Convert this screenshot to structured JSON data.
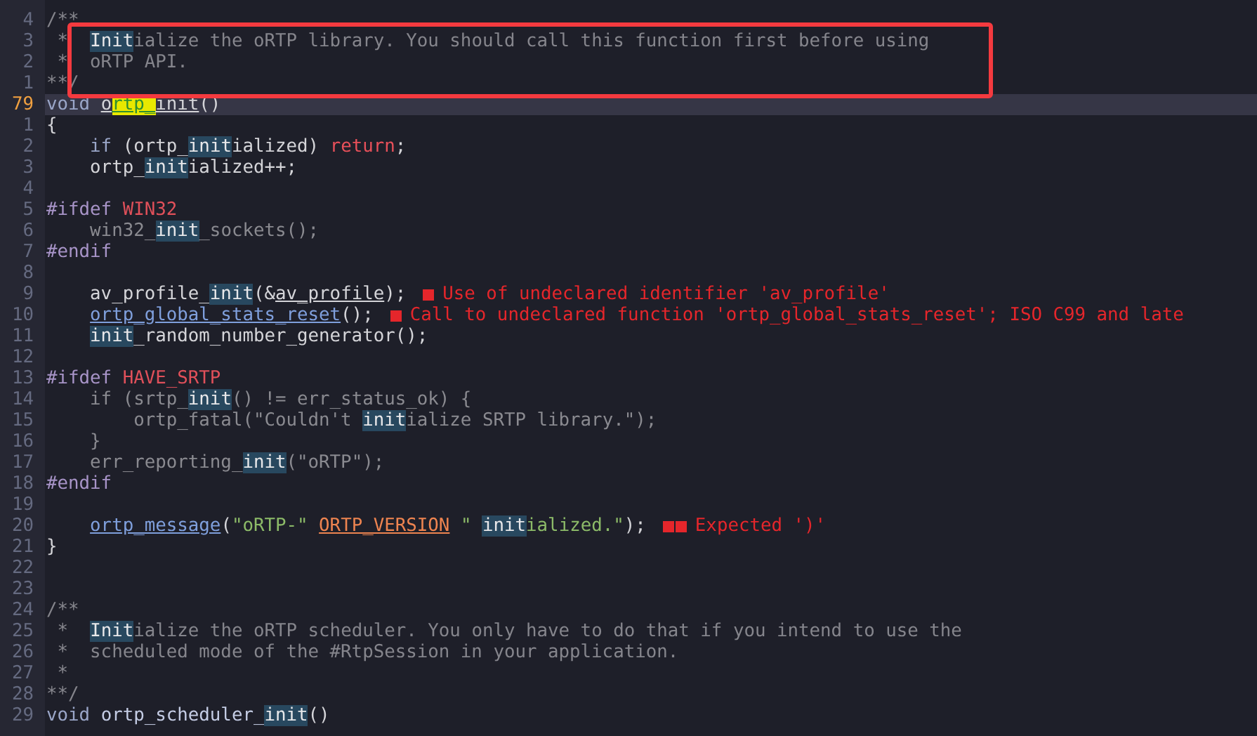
{
  "lines": [
    {
      "number": "4",
      "current": false,
      "segments": [
        {
          "text": "/**",
          "kind": "comment"
        }
      ]
    },
    {
      "number": "3",
      "current": false,
      "segments": [
        {
          "text": " *  ",
          "kind": "comment"
        },
        {
          "text": "Init",
          "kind": "match"
        },
        {
          "text": "ialize the oRTP library. You should call this function first before using",
          "kind": "comment"
        }
      ]
    },
    {
      "number": "2",
      "current": false,
      "segments": [
        {
          "text": " *  oRTP API.",
          "kind": "comment"
        }
      ]
    },
    {
      "number": "1",
      "current": false,
      "segments": [
        {
          "text": "**/",
          "kind": "comment"
        }
      ]
    },
    {
      "number": "79",
      "current": true,
      "segments": [
        {
          "text": "void ",
          "kind": "keyword"
        },
        {
          "text": "o",
          "kind": "ref"
        },
        {
          "text": "rtp_",
          "kind": "search"
        },
        {
          "text": "init",
          "kind": "ref"
        },
        {
          "text": "()",
          "kind": "plain"
        }
      ]
    },
    {
      "number": "1",
      "current": false,
      "segments": [
        {
          "text": "{",
          "kind": "plain"
        }
      ]
    },
    {
      "number": "2",
      "current": false,
      "segments": [
        {
          "text": "    if",
          "kind": "keyword"
        },
        {
          "text": " (ortp_",
          "kind": "plain"
        },
        {
          "text": "init",
          "kind": "match"
        },
        {
          "text": "ialized) ",
          "kind": "plain"
        },
        {
          "text": "return",
          "kind": "control"
        },
        {
          "text": ";",
          "kind": "plain"
        }
      ]
    },
    {
      "number": "3",
      "current": false,
      "segments": [
        {
          "text": "    ortp_",
          "kind": "plain"
        },
        {
          "text": "init",
          "kind": "match"
        },
        {
          "text": "ialized++;",
          "kind": "plain"
        }
      ]
    },
    {
      "number": "4",
      "current": false
    },
    {
      "number": "5",
      "current": false,
      "segments": [
        {
          "text": "#ifdef ",
          "kind": "preproc"
        },
        {
          "text": "WIN32",
          "kind": "macro"
        }
      ]
    },
    {
      "number": "6",
      "current": false,
      "segments": [
        {
          "text": "    win32_",
          "kind": "dim"
        },
        {
          "text": "init",
          "kind": "match"
        },
        {
          "text": "_sockets();",
          "kind": "dim"
        }
      ]
    },
    {
      "number": "7",
      "current": false,
      "segments": [
        {
          "text": "#endif",
          "kind": "preproc"
        }
      ]
    },
    {
      "number": "8",
      "current": false
    },
    {
      "number": "9",
      "current": false,
      "segments": [
        {
          "text": "    av_profile_",
          "kind": "plain"
        },
        {
          "text": "init",
          "kind": "match"
        },
        {
          "text": "(&",
          "kind": "plain"
        },
        {
          "text": "av_profile",
          "kind": "ref"
        },
        {
          "text": ");",
          "kind": "plain"
        }
      ],
      "diagnostics": [
        {
          "kind": "error",
          "message": "Use of undeclared identifier 'av_profile'"
        }
      ]
    },
    {
      "number": "10",
      "current": false,
      "segments": [
        {
          "text": "    ortp_global_stats_reset",
          "kind": "func"
        },
        {
          "text": "();",
          "kind": "plain"
        }
      ],
      "diagnostics": [
        {
          "kind": "error",
          "message": "Call to undeclared function 'ortp_global_stats_reset'; ISO C99 and late"
        }
      ]
    },
    {
      "number": "11",
      "current": false,
      "segments": [
        {
          "text": "    init",
          "kind": "match"
        },
        {
          "text": "_random_number_generator();",
          "kind": "plain"
        }
      ]
    },
    {
      "number": "12",
      "current": false
    },
    {
      "number": "13",
      "current": false,
      "segments": [
        {
          "text": "#ifdef ",
          "kind": "preproc"
        },
        {
          "text": "HAVE_SRTP",
          "kind": "macro"
        }
      ]
    },
    {
      "number": "14",
      "current": false,
      "segments": [
        {
          "text": "    if (srtp_",
          "kind": "dim"
        },
        {
          "text": "init",
          "kind": "match"
        },
        {
          "text": "() != err_status_ok) {",
          "kind": "dim"
        }
      ]
    },
    {
      "number": "15",
      "current": false,
      "segments": [
        {
          "text": "        ortp_fatal(\"Couldn't ",
          "kind": "dim"
        },
        {
          "text": "init",
          "kind": "match"
        },
        {
          "text": "ialize SRTP library.\");",
          "kind": "dim"
        }
      ]
    },
    {
      "number": "16",
      "current": false,
      "segments": [
        {
          "text": "    }",
          "kind": "dim"
        }
      ]
    },
    {
      "number": "17",
      "current": false,
      "segments": [
        {
          "text": "    err_reporting_",
          "kind": "dim"
        },
        {
          "text": "init",
          "kind": "match"
        },
        {
          "text": "(\"oRTP\");",
          "kind": "dim"
        }
      ]
    },
    {
      "number": "18",
      "current": false,
      "segments": [
        {
          "text": "#endif",
          "kind": "preproc"
        }
      ]
    },
    {
      "number": "19",
      "current": false
    },
    {
      "number": "20",
      "current": false,
      "segments": [
        {
          "text": "    ortp_message",
          "kind": "func"
        },
        {
          "text": "(",
          "kind": "plain"
        },
        {
          "text": "\"oRTP-\" ",
          "kind": "string"
        },
        {
          "text": "ORTP_VERSION",
          "kind": "constant"
        },
        {
          "text": " \" ",
          "kind": "string"
        },
        {
          "text": "init",
          "kind": "match"
        },
        {
          "text": "ialized.\"",
          "kind": "string"
        },
        {
          "text": ");",
          "kind": "plain"
        }
      ],
      "diagnostics": [
        {
          "kind": "error",
          "message": "Expected ')'"
        },
        {
          "kind": "error"
        }
      ]
    },
    {
      "number": "21",
      "current": false,
      "segments": [
        {
          "text": "}",
          "kind": "plain"
        }
      ]
    },
    {
      "number": "22",
      "current": false
    },
    {
      "number": "23",
      "current": false
    },
    {
      "number": "24",
      "current": false,
      "segments": [
        {
          "text": "/**",
          "kind": "comment"
        }
      ]
    },
    {
      "number": "25",
      "current": false,
      "segments": [
        {
          "text": " *  ",
          "kind": "comment"
        },
        {
          "text": "Init",
          "kind": "match"
        },
        {
          "text": "ialize the oRTP scheduler. You only have to do that if you intend to use the",
          "kind": "comment"
        }
      ]
    },
    {
      "number": "26",
      "current": false,
      "segments": [
        {
          "text": " *  scheduled mode of the #RtpSession in your application.",
          "kind": "comment"
        }
      ]
    },
    {
      "number": "27",
      "current": false,
      "segments": [
        {
          "text": " *",
          "kind": "comment"
        }
      ]
    },
    {
      "number": "28",
      "current": false,
      "segments": [
        {
          "text": "**/",
          "kind": "comment"
        }
      ]
    },
    {
      "number": "29",
      "current": false,
      "segments": [
        {
          "text": "void ",
          "kind": "keyword"
        },
        {
          "text": "ortp_scheduler_",
          "kind": "name"
        },
        {
          "text": "init",
          "kind": "match"
        },
        {
          "text": "()",
          "kind": "plain"
        }
      ]
    }
  ]
}
